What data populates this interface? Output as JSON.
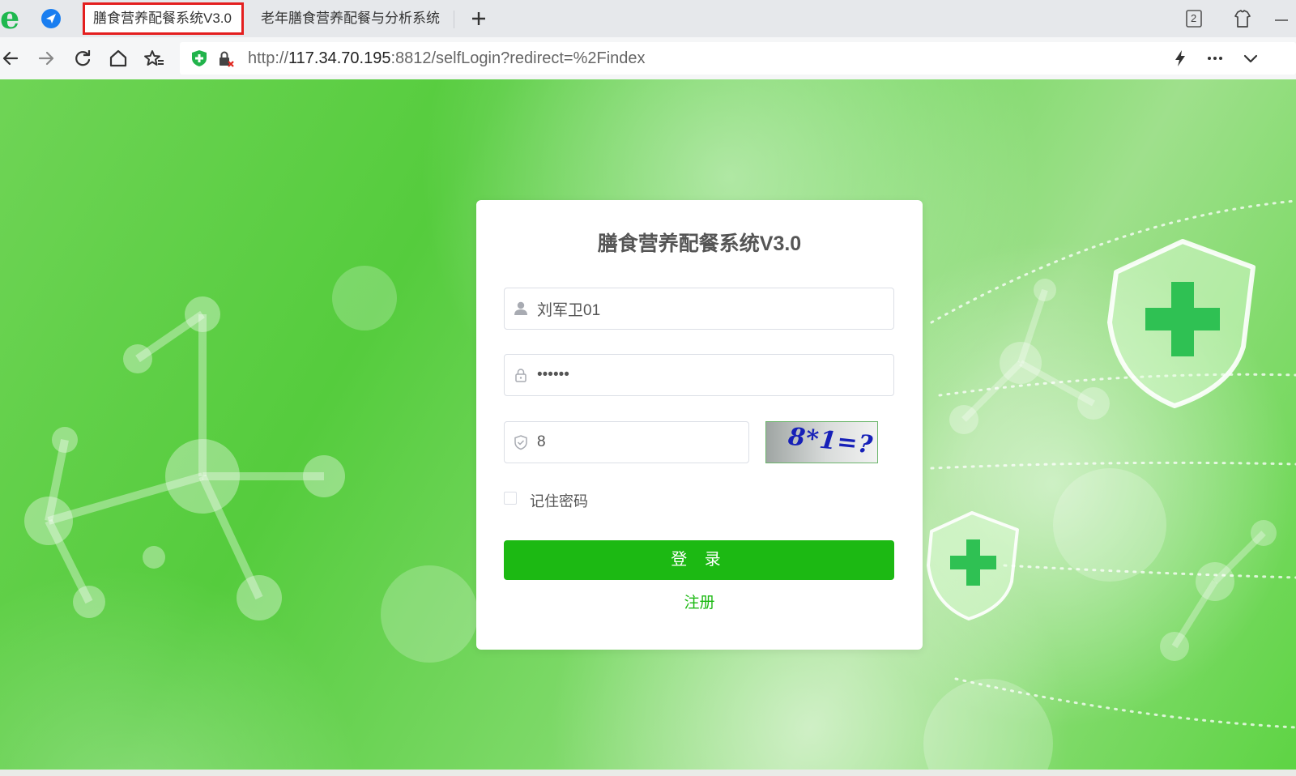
{
  "browser": {
    "tabs": [
      {
        "label": "膳食营养配餐系统V3.0",
        "active": true
      },
      {
        "label": "老年膳食营养配餐与分析系统",
        "active": false
      }
    ],
    "tab_counter": "2",
    "url": {
      "protocol": "http://",
      "host": "117.34.70.195",
      "rest": ":8812/selfLogin?redirect=%2Findex"
    }
  },
  "login": {
    "title": "膳食营养配餐系统V3.0",
    "username_value": "刘军卫01",
    "password_value": "••••••",
    "captcha_input_value": "8",
    "captcha_image_text": "8*1=?",
    "remember_label": "记住密码",
    "remember_checked": false,
    "login_button": "登 录",
    "register_link": "注册"
  },
  "icons": {
    "browser_logo": "browser-logo-icon",
    "send": "send-icon",
    "back": "back-icon",
    "forward": "forward-icon",
    "reload": "reload-icon",
    "home": "home-icon",
    "favorites": "favorites-icon",
    "shield": "shield-icon",
    "insecure_lock": "insecure-lock-icon",
    "lightning": "lightning-icon",
    "more": "more-icon",
    "chevron_down": "chevron-down-icon",
    "user": "user-icon",
    "lock": "lock-icon",
    "verify": "verify-shield-icon"
  },
  "colors": {
    "accent_green": "#1cb913",
    "tab_highlight": "#e41f1f",
    "background_green": "#55cc3d",
    "captcha_text": "#1620b8"
  }
}
